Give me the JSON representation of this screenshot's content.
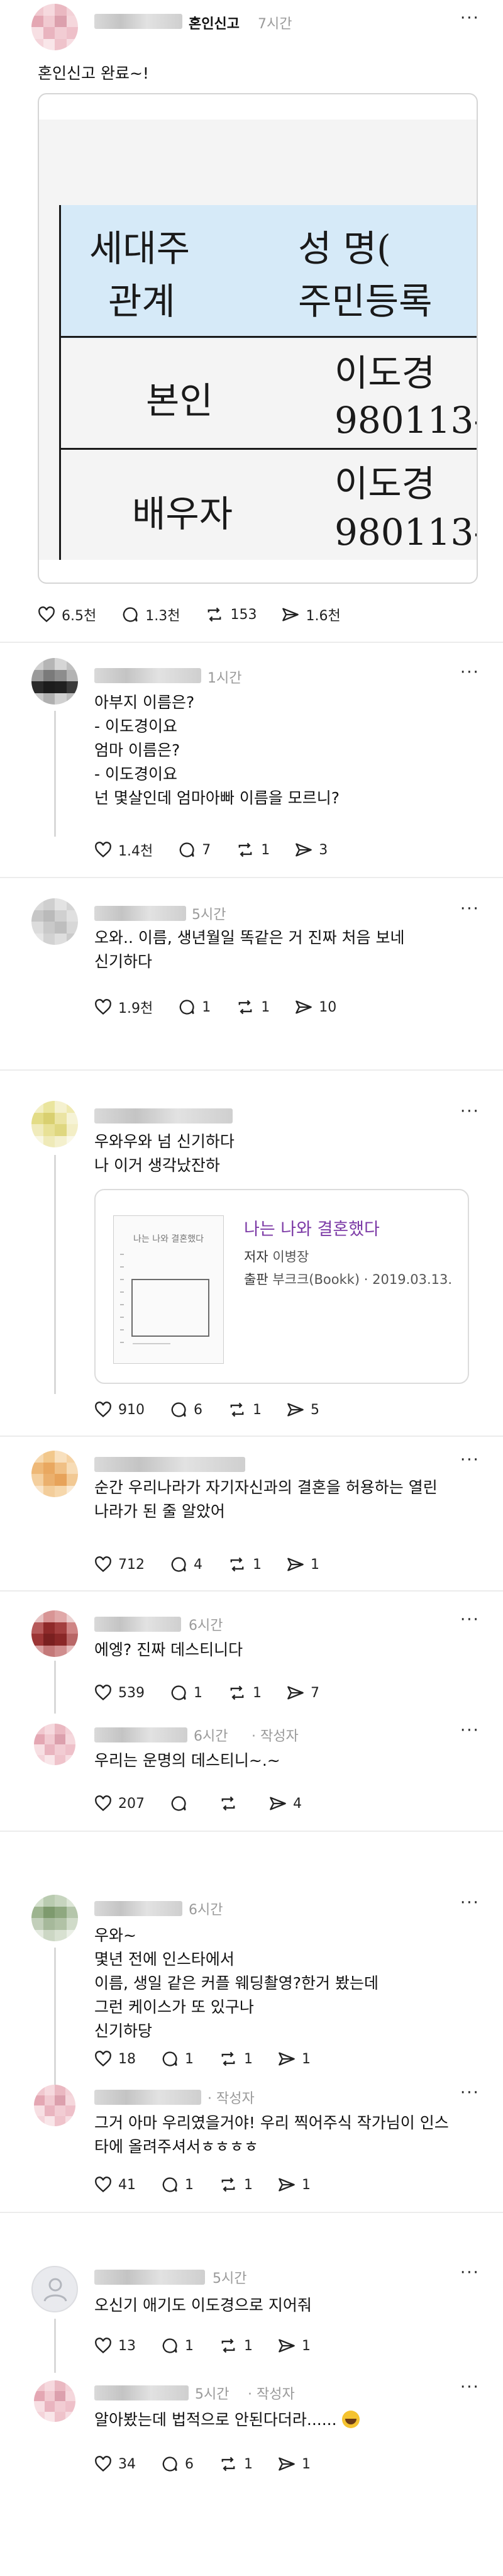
{
  "post": {
    "label": "혼인신고",
    "time": "7시간",
    "text": "혼인신고 완료~!",
    "certificate": {
      "header_col1_line1": "세대주",
      "header_col1_line2": "관계",
      "header_col2_line1": "성  명(",
      "header_col2_line2": "주민등록",
      "row1_relation": "본인",
      "row1_name": "이도경",
      "row1_id": "980113-",
      "row2_relation": "배우자",
      "row2_name": "이도경",
      "row2_id": "980113-"
    },
    "likes": "6.5천",
    "replies": "1.3천",
    "reposts": "153",
    "shares": "1.6천"
  },
  "comments": [
    {
      "time": "1시간",
      "text": "아부지 이름은?\n- 이도경이요\n엄마 이름은?\n- 이도경이요\n넌 몇살인데 엄마아빠 이름을 모르니?",
      "likes": "1.4천",
      "replies": "7",
      "reposts": "1",
      "shares": "3"
    },
    {
      "time": "5시간",
      "text": "오와.. 이름, 생년월일 똑같은 거 진짜 처음 보네\n신기하다",
      "likes": "1.9천",
      "replies": "1",
      "reposts": "1",
      "shares": "10"
    },
    {
      "time": "",
      "text": "우와우와 넘 신기하다\n나 이거 생각났잔하",
      "likes": "910",
      "replies": "6",
      "reposts": "1",
      "shares": "5"
    },
    {
      "time": "",
      "text": "순간 우리나라가 자기자신과의 결혼을 허용하는 열린\n나라가 된 줄 알았어",
      "likes": "712",
      "replies": "4",
      "reposts": "1",
      "shares": "1"
    },
    {
      "time": "6시간",
      "text": "에엥? 진짜 데스티니다",
      "likes": "539",
      "replies": "1",
      "reposts": "1",
      "shares": "7"
    },
    {
      "time": "6시간",
      "author_tag": "작성자",
      "text": "우리는 운명의 데스티니~.~",
      "likes": "207",
      "shares": "4"
    },
    {
      "time": "6시간",
      "text": "우와~\n몇년 전에 인스타에서\n이름, 생일 같은 커플 웨딩촬영?한거 봤는데\n그런 케이스가 또 있구나\n신기하당",
      "likes": "18",
      "replies": "1",
      "reposts": "1",
      "shares": "1"
    },
    {
      "time": "",
      "author_tag": "작성자",
      "text": "그거 아마 우리였을거야! 우리 찍어주식 작가님이 인스\n타에 올려주셔서ㅎㅎㅎㅎ",
      "likes": "41",
      "replies": "1",
      "reposts": "1",
      "shares": "1"
    },
    {
      "time": "5시간",
      "text": "오신기 애기도 이도경으로 지어줘",
      "likes": "13",
      "replies": "1",
      "reposts": "1",
      "shares": "1"
    },
    {
      "time": "5시간",
      "author_tag": "작성자",
      "text": "알아봤는데 법적으로 안된다더라......",
      "likes": "34",
      "replies": "6",
      "reposts": "1",
      "shares": "1"
    }
  ],
  "book": {
    "cover_title": "나는 나와 결혼했다",
    "title": "나는 나와 결혼했다",
    "author_label": "저자",
    "author": "이병장",
    "publisher_label": "출판",
    "publisher": "부크크(Bookk)",
    "date": "· 2019.03.13."
  },
  "colors": {
    "accent_purple": "#7c3aa6",
    "cert_header_blue": "#d6eaf8"
  }
}
